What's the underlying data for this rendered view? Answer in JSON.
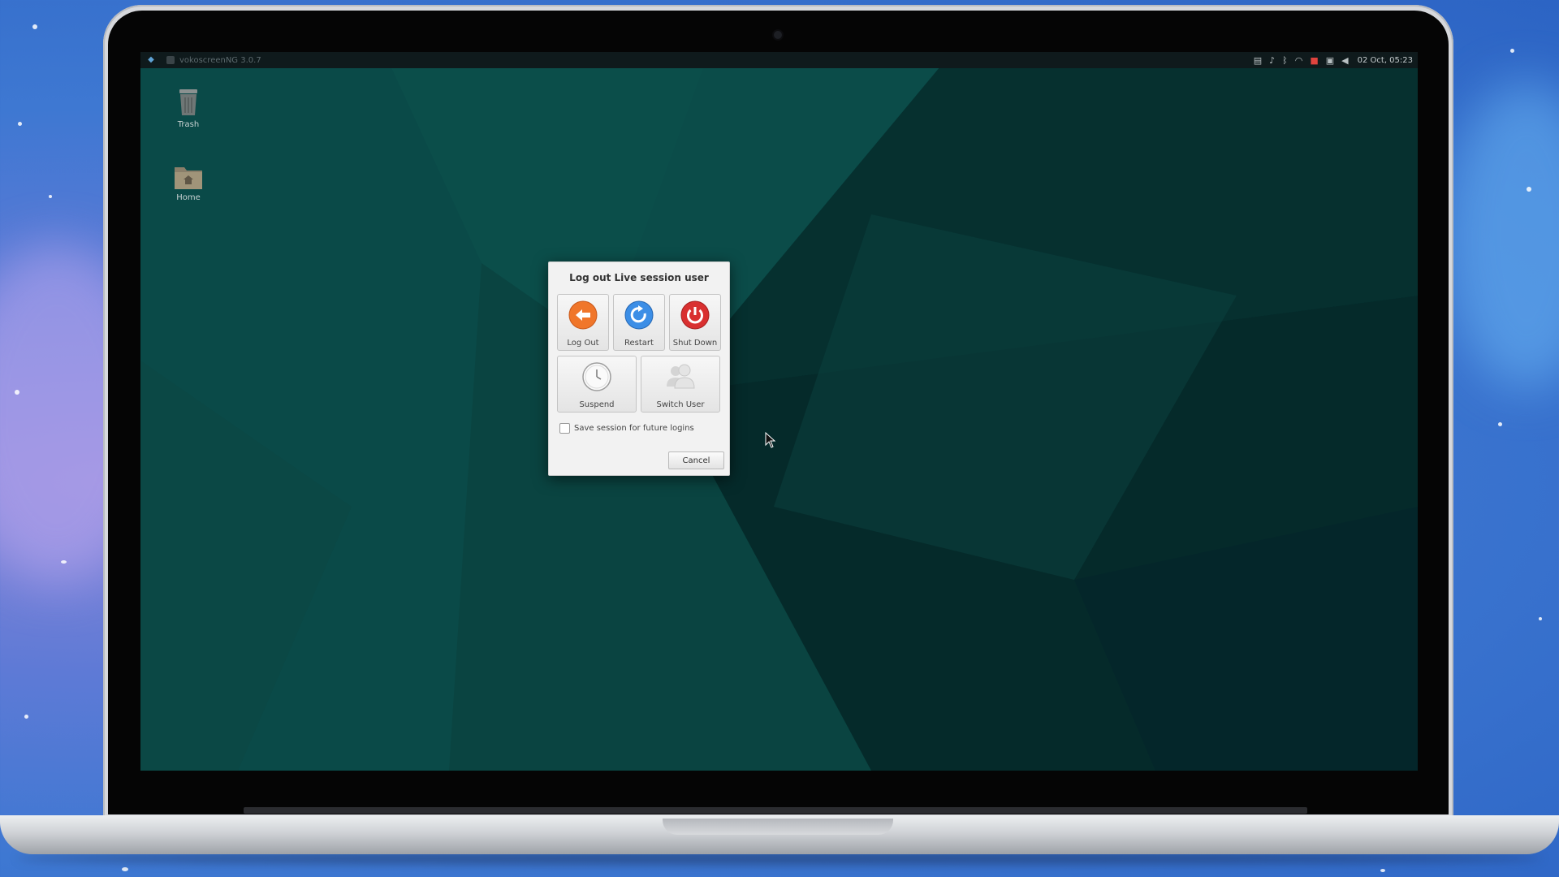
{
  "topbar": {
    "task_label": "vokoscreenNG 3.0.7",
    "clock": "02 Oct, 05:23",
    "tray_icons": [
      "clipboard-icon",
      "bell-icon",
      "bluetooth-icon",
      "wifi-icon",
      "recording-icon",
      "lock-icon",
      "volume-icon"
    ]
  },
  "desktop": {
    "icons": [
      {
        "label": "Trash",
        "icon": "trash-icon"
      },
      {
        "label": "Home",
        "icon": "home-folder-icon"
      }
    ]
  },
  "dialog": {
    "title": "Log out Live session user",
    "actions": [
      {
        "label": "Log Out",
        "icon": "logout-icon",
        "color": "#f0762a"
      },
      {
        "label": "Restart",
        "icon": "restart-icon",
        "color": "#3c8ee6"
      },
      {
        "label": "Shut Down",
        "icon": "power-icon",
        "color": "#d93030"
      },
      {
        "label": "Suspend",
        "icon": "clock-icon",
        "color": "#e8e8e8"
      },
      {
        "label": "Switch User",
        "icon": "users-icon",
        "color": "#d0d0d0"
      }
    ],
    "save_session_label": "Save session for future logins",
    "save_session_checked": false,
    "cancel_label": "Cancel"
  },
  "colors": {
    "wallpaper": "#07393a",
    "panel": "#0f1a1c",
    "dialog_bg": "#f2f2f2"
  }
}
